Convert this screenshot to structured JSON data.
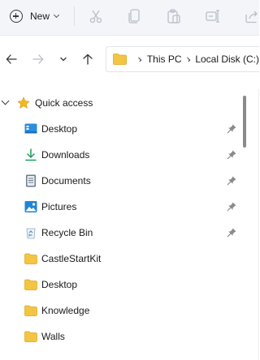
{
  "toolbar": {
    "new_label": "New",
    "icons": [
      "new-plus-icon",
      "cut-icon",
      "copy-icon",
      "paste-icon",
      "rename-icon",
      "share-icon"
    ]
  },
  "nav": {
    "buttons": [
      "back-arrow-icon",
      "forward-arrow-icon",
      "recent-chevron-icon",
      "up-arrow-icon"
    ]
  },
  "address": {
    "crumbs": [
      "This PC",
      "Local Disk (C:)"
    ]
  },
  "sidebar": {
    "quick_access_label": "Quick access",
    "items": [
      {
        "label": "Desktop",
        "icon": "desktop-icon",
        "pinned": true
      },
      {
        "label": "Downloads",
        "icon": "downloads-icon",
        "pinned": true
      },
      {
        "label": "Documents",
        "icon": "documents-icon",
        "pinned": true
      },
      {
        "label": "Pictures",
        "icon": "pictures-icon",
        "pinned": true
      },
      {
        "label": "Recycle Bin",
        "icon": "recycle-bin-icon",
        "pinned": true
      },
      {
        "label": "CastleStartKit",
        "icon": "folder-icon",
        "pinned": false
      },
      {
        "label": "Desktop",
        "icon": "folder-icon",
        "pinned": false
      },
      {
        "label": "Knowledge",
        "icon": "folder-icon",
        "pinned": false
      },
      {
        "label": "Walls",
        "icon": "folder-icon",
        "pinned": false
      }
    ]
  },
  "colors": {
    "folder_yellow": "#f4c542",
    "accent_blue": "#1a73e8",
    "star_yellow": "#f2b822"
  }
}
